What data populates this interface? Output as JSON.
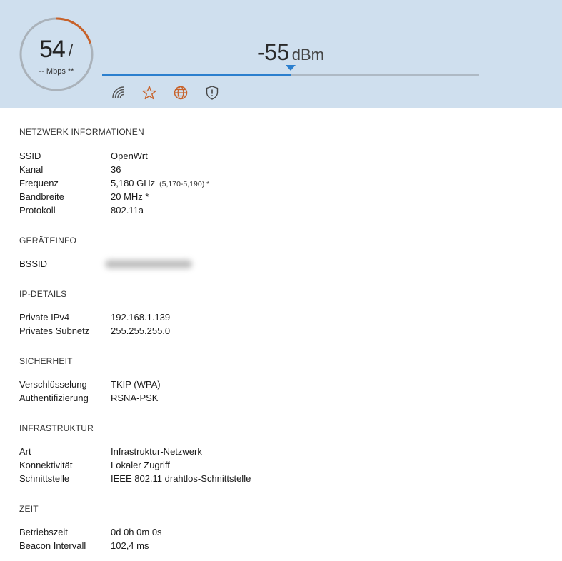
{
  "gauge": {
    "speed": "54",
    "slash": "/",
    "unit": "-- Mbps **",
    "arc_fraction": 0.2,
    "arc_color": "#c8622a",
    "ring_color": "#aab2ba"
  },
  "signal": {
    "value": "-55",
    "unit": "dBm",
    "level_fraction": 0.5
  },
  "icons": [
    {
      "name": "wifi-icon"
    },
    {
      "name": "star-icon"
    },
    {
      "name": "globe-icon"
    },
    {
      "name": "shield-icon"
    }
  ],
  "colors": {
    "header_bg": "#cfdfee",
    "accent": "#2b7fce",
    "orange": "#c8622a"
  },
  "sections": {
    "network": {
      "title": "NETZWERK INFORMATIONEN",
      "rows": [
        {
          "k": "SSID",
          "v": "OpenWrt"
        },
        {
          "k": "Kanal",
          "v": "36"
        },
        {
          "k": "Frequenz",
          "v": "5,180 GHz",
          "extra": "(5,170-5,190) *"
        },
        {
          "k": "Bandbreite",
          "v": "20 MHz *"
        },
        {
          "k": "Protokoll",
          "v": "802.11a"
        }
      ]
    },
    "device": {
      "title": "GERÄTEINFO",
      "rows": [
        {
          "k": "BSSID",
          "v": ""
        }
      ]
    },
    "ip": {
      "title": "IP-DETAILS",
      "rows": [
        {
          "k": "Private IPv4",
          "v": "192.168.1.139"
        },
        {
          "k": "Privates Subnetz",
          "v": "255.255.255.0"
        }
      ]
    },
    "security": {
      "title": "SICHERHEIT",
      "rows": [
        {
          "k": "Verschlüsselung",
          "v": "TKIP (WPA)"
        },
        {
          "k": "Authentifizierung",
          "v": "RSNA-PSK"
        }
      ]
    },
    "infra": {
      "title": "INFRASTRUKTUR",
      "rows": [
        {
          "k": "Art",
          "v": "Infrastruktur-Netzwerk"
        },
        {
          "k": "Konnektivität",
          "v": "Lokaler Zugriff"
        },
        {
          "k": "Schnittstelle",
          "v": "IEEE 802.11 drahtlos-Schnittstelle"
        }
      ]
    },
    "time": {
      "title": "ZEIT",
      "rows": [
        {
          "k": "Betriebszeit",
          "v": "0d 0h 0m 0s"
        },
        {
          "k": "Beacon Intervall",
          "v": "102,4 ms"
        }
      ]
    }
  }
}
